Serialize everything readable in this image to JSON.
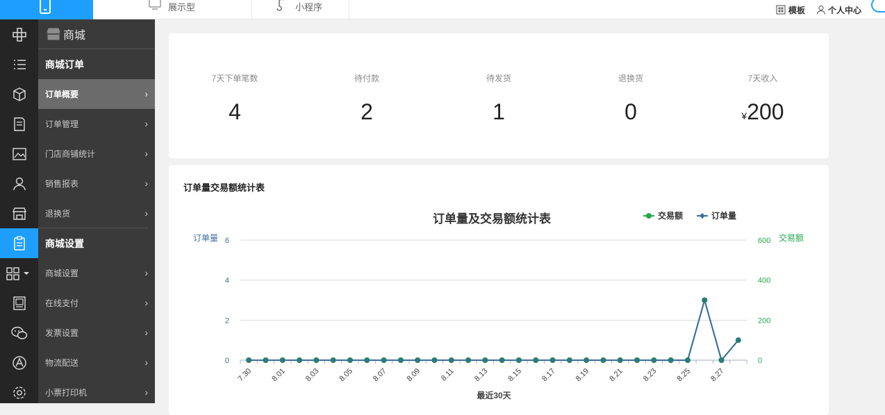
{
  "topbar": {
    "tabs": [
      {
        "label": "展示型",
        "icon": "monitor-icon"
      },
      {
        "label": "小程序",
        "icon": "mini-program-icon"
      }
    ],
    "template_label": "模板",
    "profile_label": "个人中心"
  },
  "sidebar": {
    "header": "商城",
    "section_orders": "商城订单",
    "items": [
      {
        "label": "订单概要",
        "active": true
      },
      {
        "label": "订单管理"
      },
      {
        "label": "门店商铺统计"
      },
      {
        "label": "销售报表"
      },
      {
        "label": "退换货"
      }
    ],
    "section_settings": "商城设置",
    "settings_items": [
      {
        "label": "商城设置"
      },
      {
        "label": "在线支付"
      },
      {
        "label": "发票设置"
      },
      {
        "label": "物流配送"
      },
      {
        "label": "小票打印机"
      }
    ],
    "rail_icons": [
      "crosshair-icon",
      "list-icon",
      "cube-icon",
      "document-icon",
      "image-icon",
      "user-icon",
      "store-icon",
      "clipboard-icon",
      "apps-icon",
      "picture-frame-icon",
      "wechat-icon",
      "shop-a-icon",
      "settings-icon"
    ]
  },
  "stats": [
    {
      "label": "7天下单笔数",
      "value": "4"
    },
    {
      "label": "待付款",
      "value": "2"
    },
    {
      "label": "待发货",
      "value": "1"
    },
    {
      "label": "退换货",
      "value": "0"
    },
    {
      "label": "7天收入",
      "currency": "¥",
      "value": "200"
    }
  ],
  "chart_section_title": "订单量交易额统计表",
  "chart_data": {
    "type": "line",
    "title": "订单量及交易额统计表",
    "xlabel": "最近30天",
    "ylabel_left": "订单量",
    "ylabel_right": "交易额",
    "ylim_left": [
      0,
      6
    ],
    "ylim_right": [
      0,
      600
    ],
    "yticks_left": [
      0,
      2,
      4,
      6
    ],
    "yticks_right": [
      0,
      200,
      400,
      600
    ],
    "x": [
      "7.30",
      "7.31",
      "8.01",
      "8.02",
      "8.03",
      "8.04",
      "8.05",
      "8.06",
      "8.07",
      "8.08",
      "8.09",
      "8.10",
      "8.11",
      "8.12",
      "8.13",
      "8.14",
      "8.15",
      "8.16",
      "8.17",
      "8.18",
      "8.19",
      "8.20",
      "8.21",
      "8.22",
      "8.23",
      "8.24",
      "8.25",
      "8.26",
      "8.27",
      "8.28"
    ],
    "xtick_labels": [
      "7.30",
      "8.01",
      "8.03",
      "8.05",
      "8.07",
      "8.09",
      "8.11",
      "8.13",
      "8.15",
      "8.17",
      "8.19",
      "8.21",
      "8.23",
      "8.25",
      "8.27"
    ],
    "legend_position": "top-right",
    "grid": true,
    "series": [
      {
        "name": "交易额",
        "axis": "right",
        "color": "#20a84b",
        "values": [
          0,
          0,
          0,
          0,
          0,
          0,
          0,
          0,
          0,
          0,
          0,
          0,
          0,
          0,
          0,
          0,
          0,
          0,
          0,
          0,
          0,
          0,
          0,
          0,
          0,
          0,
          0,
          300,
          0,
          100
        ]
      },
      {
        "name": "订单量",
        "axis": "left",
        "color": "#3b6e9e",
        "values": [
          0,
          0,
          0,
          0,
          0,
          0,
          0,
          0,
          0,
          0,
          0,
          0,
          0,
          0,
          0,
          0,
          0,
          0,
          0,
          0,
          0,
          0,
          0,
          0,
          0,
          0,
          0,
          3,
          0,
          1
        ]
      }
    ]
  }
}
